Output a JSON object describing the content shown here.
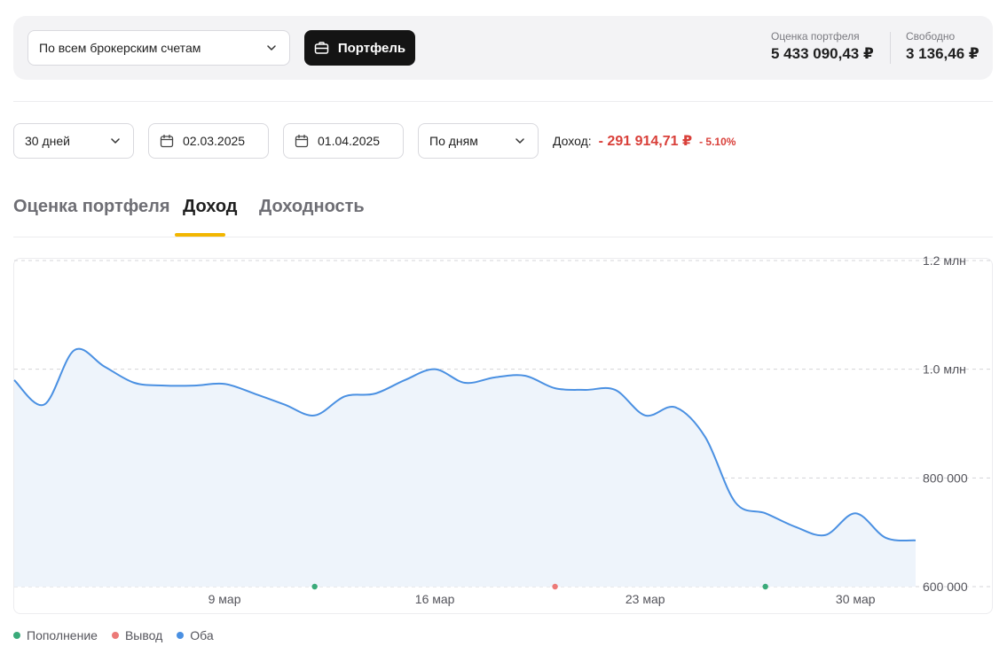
{
  "topbar": {
    "account_select": "По всем брокерским счетам",
    "portfolio_button": "Портфель",
    "portfolio_value_caption": "Оценка портфеля",
    "portfolio_value": "5 433 090,43 ₽",
    "free_caption": "Свободно",
    "free_value": "3 136,46 ₽"
  },
  "filters": {
    "period": "30 дней",
    "date_from": "02.03.2025",
    "date_to": "01.04.2025",
    "granularity": "По дням",
    "income_label": "Доход:",
    "income_value": "- 291 914,71 ₽",
    "income_percent": "- 5.10%"
  },
  "tabs": [
    {
      "label": "Оценка портфеля",
      "active": false
    },
    {
      "label": "Доход",
      "active": true
    },
    {
      "label": "Доходность",
      "active": false
    }
  ],
  "colors": {
    "line": "#4a90e2",
    "area": "#eef4fb",
    "deposit": "#3aaa7a",
    "withdraw": "#ec7a78",
    "both": "#4a90e2",
    "grid": "#d4d4d8",
    "accent": "#f2b600",
    "negative": "#d9403a"
  },
  "chart_data": {
    "type": "area",
    "x": [
      "02.03",
      "03.03",
      "04.03",
      "05.03",
      "06.03",
      "07.03",
      "08.03",
      "09.03",
      "10.03",
      "11.03",
      "12.03",
      "13.03",
      "14.03",
      "15.03",
      "16.03",
      "17.03",
      "18.03",
      "19.03",
      "20.03",
      "21.03",
      "22.03",
      "23.03",
      "24.03",
      "25.03",
      "26.03",
      "27.03",
      "28.03",
      "29.03",
      "30.03",
      "31.03",
      "01.04"
    ],
    "values": [
      980000,
      935000,
      1035000,
      1005000,
      975000,
      970000,
      970000,
      973000,
      955000,
      935000,
      915000,
      950000,
      955000,
      980000,
      1000000,
      975000,
      985000,
      988000,
      965000,
      962000,
      962000,
      915000,
      930000,
      875000,
      755000,
      735000,
      710000,
      695000,
      735000,
      690000,
      685000
    ],
    "x_tick_labels": [
      {
        "x": "09.03",
        "label": "9 мар"
      },
      {
        "x": "16.03",
        "label": "16 мар"
      },
      {
        "x": "23.03",
        "label": "23 мар"
      },
      {
        "x": "30.03",
        "label": "30 мар"
      }
    ],
    "y_ticks": [
      {
        "value": 600000,
        "label": "600 000"
      },
      {
        "value": 800000,
        "label": "800 000"
      },
      {
        "value": 1000000,
        "label": "1.0 млн"
      },
      {
        "value": 1200000,
        "label": "1.2 млн"
      }
    ],
    "ylim": [
      600000,
      1200000
    ],
    "events": [
      {
        "x": "12.03",
        "type": "deposit"
      },
      {
        "x": "20.03",
        "type": "withdraw"
      },
      {
        "x": "27.03",
        "type": "deposit"
      }
    ],
    "legend": [
      {
        "label": "Пополнение",
        "type": "deposit"
      },
      {
        "label": "Вывод",
        "type": "withdraw"
      },
      {
        "label": "Оба",
        "type": "both"
      }
    ],
    "grid": true,
    "legend_position": "bottom-left"
  }
}
